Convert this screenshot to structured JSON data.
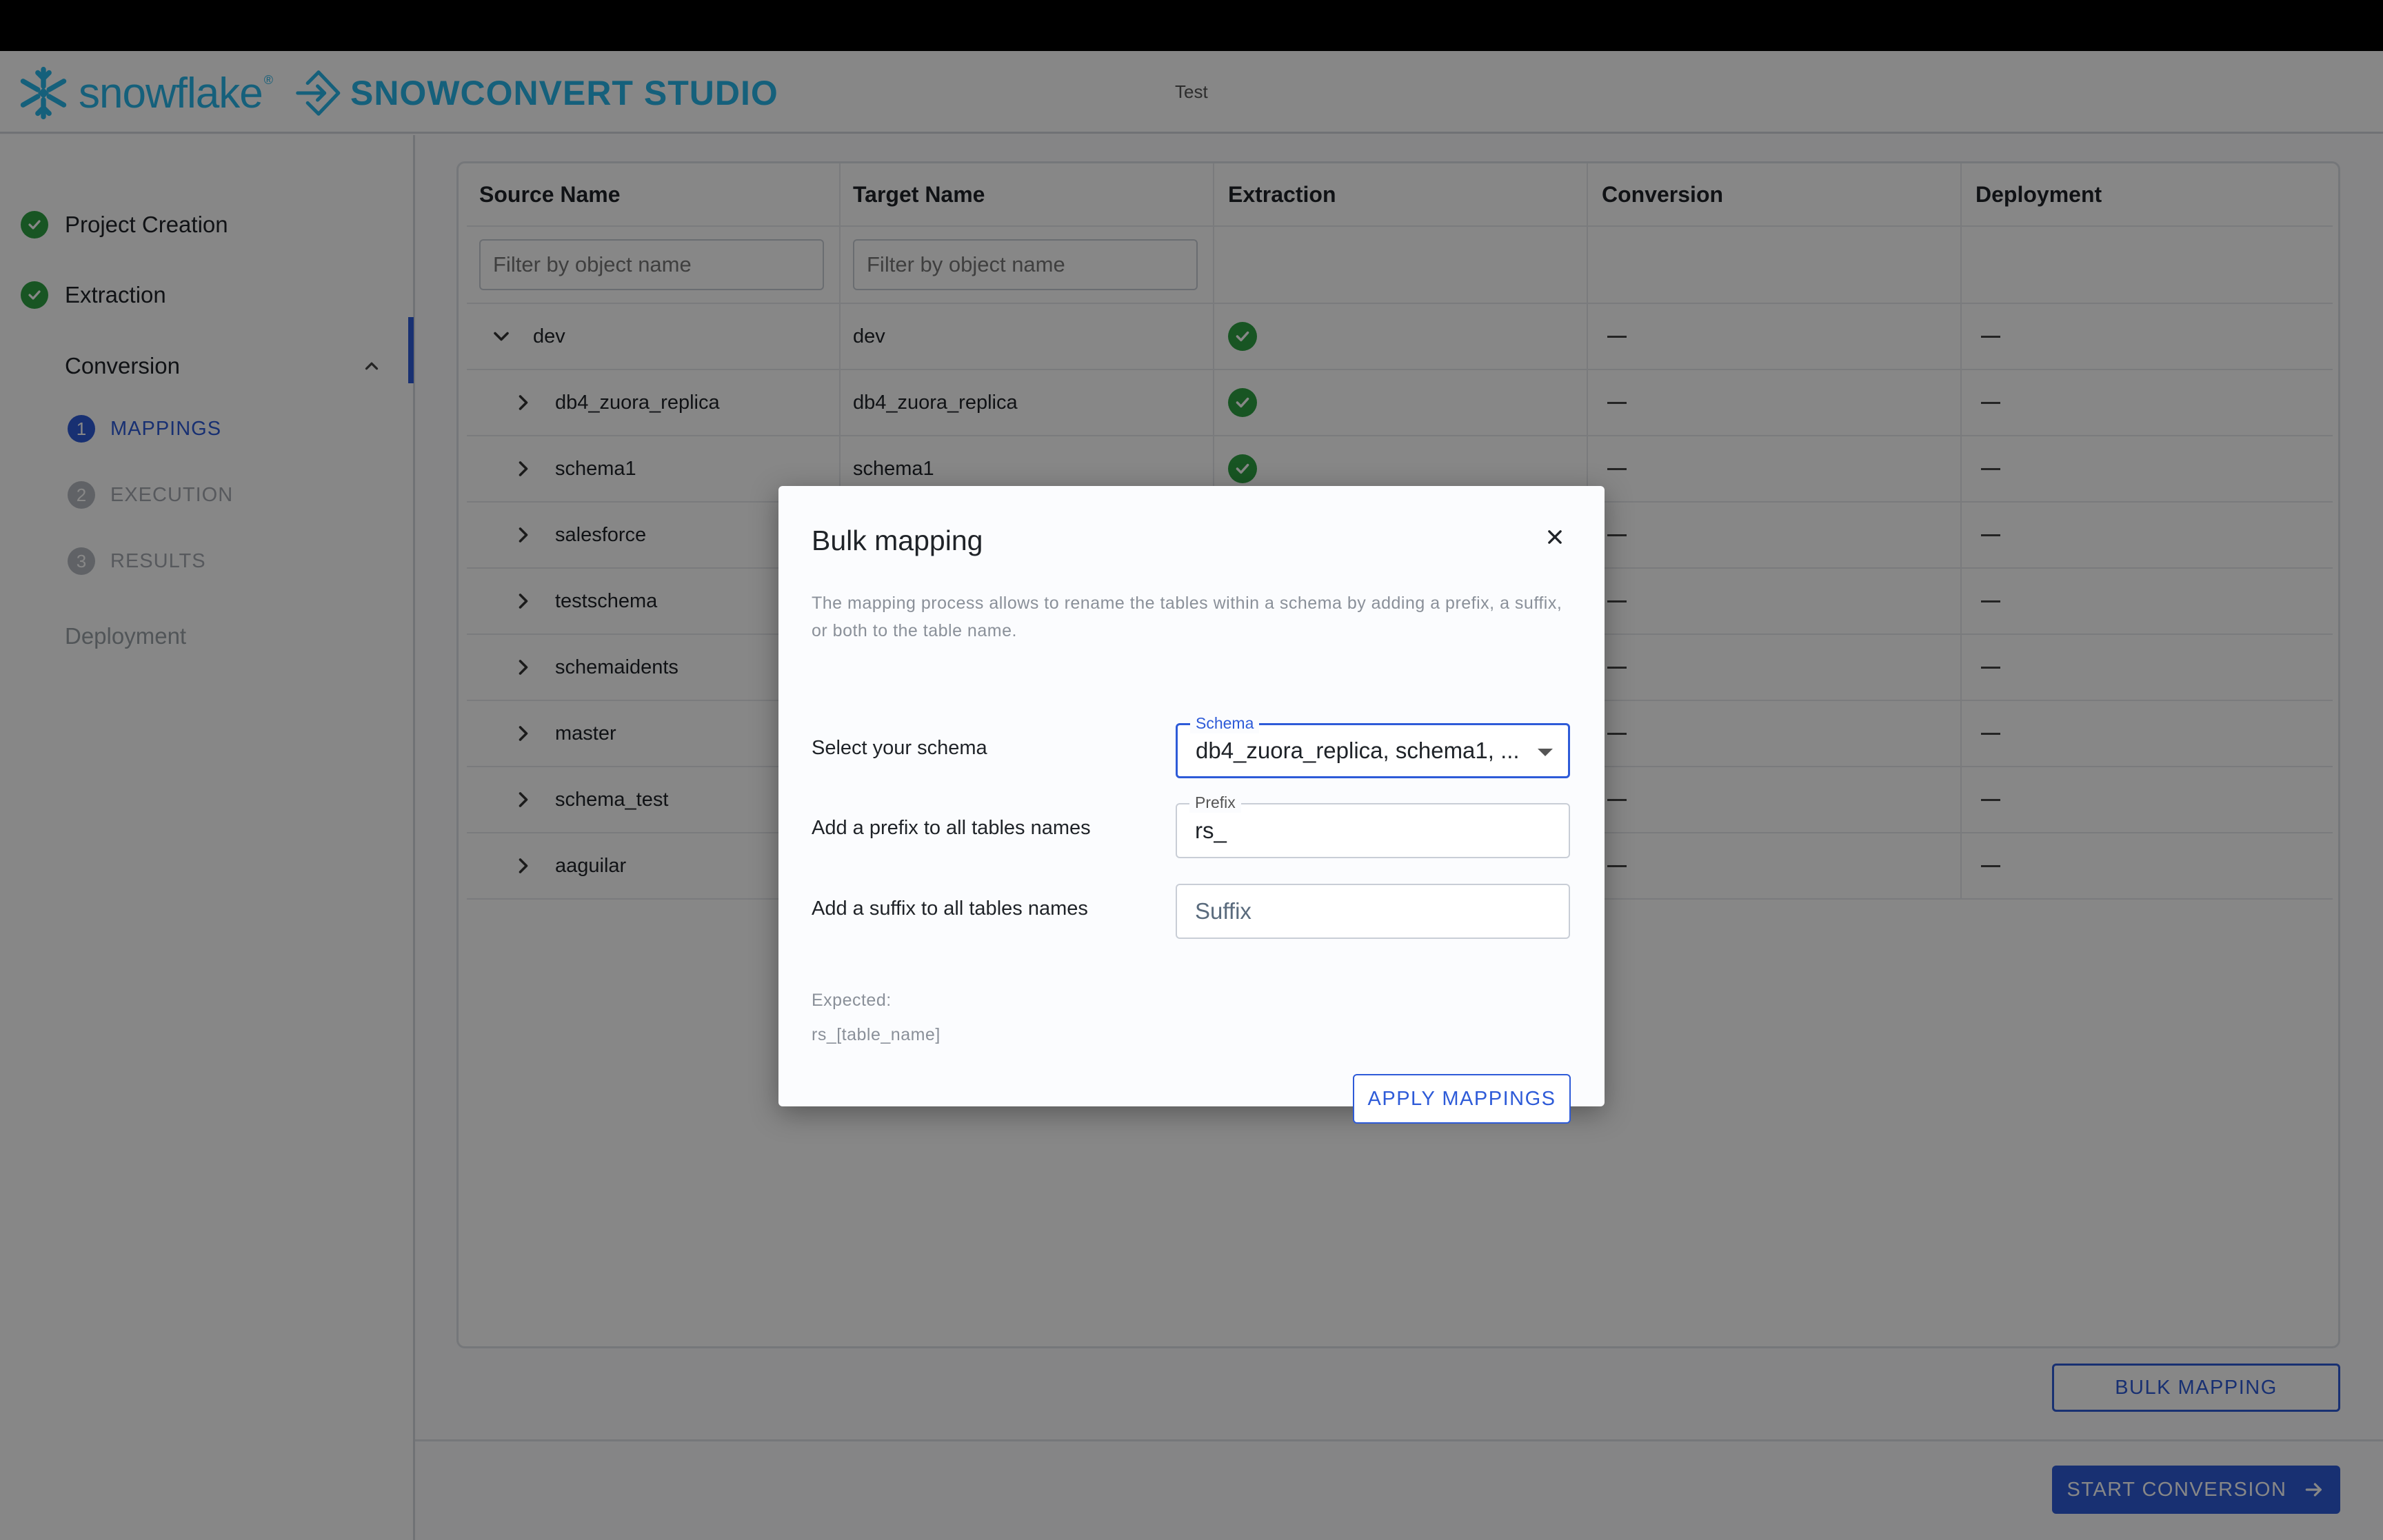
{
  "header": {
    "snowflake_logo_text": "snowflake",
    "snowflake_tm": "®",
    "product_name": "SNOWCONVERT STUDIO",
    "project_title": "Test"
  },
  "sidebar": {
    "steps": [
      {
        "label": "Project Creation",
        "status": "complete"
      },
      {
        "label": "Extraction",
        "status": "complete"
      }
    ],
    "conversion": {
      "label": "Conversion",
      "substeps": [
        {
          "number": "1",
          "label": "MAPPINGS",
          "state": "active"
        },
        {
          "number": "2",
          "label": "EXECUTION",
          "state": "inactive"
        },
        {
          "number": "3",
          "label": "RESULTS",
          "state": "inactive"
        }
      ]
    },
    "deployment_label": "Deployment"
  },
  "table": {
    "columns": [
      "Source Name",
      "Target Name",
      "Extraction",
      "Conversion",
      "Deployment"
    ],
    "filter_placeholder": "Filter by object name",
    "rows": [
      {
        "source": "dev",
        "target": "dev",
        "extraction": "ok",
        "conversion": "—",
        "deployment": "—",
        "expanded": true,
        "level": 0
      },
      {
        "source": "db4_zuora_replica",
        "target": "db4_zuora_replica",
        "extraction": "ok",
        "conversion": "—",
        "deployment": "—",
        "expanded": false,
        "level": 1
      },
      {
        "source": "schema1",
        "target": "schema1",
        "extraction": "ok",
        "conversion": "—",
        "deployment": "—",
        "expanded": false,
        "level": 1
      },
      {
        "source": "salesforce",
        "target": "",
        "extraction": "",
        "conversion": "—",
        "deployment": "—",
        "expanded": false,
        "level": 1
      },
      {
        "source": "testschema",
        "target": "",
        "extraction": "",
        "conversion": "—",
        "deployment": "—",
        "expanded": false,
        "level": 1
      },
      {
        "source": "schemaidents",
        "target": "",
        "extraction": "",
        "conversion": "—",
        "deployment": "—",
        "expanded": false,
        "level": 1
      },
      {
        "source": "master",
        "target": "",
        "extraction": "",
        "conversion": "—",
        "deployment": "—",
        "expanded": false,
        "level": 1
      },
      {
        "source": "schema_test",
        "target": "",
        "extraction": "",
        "conversion": "—",
        "deployment": "—",
        "expanded": false,
        "level": 1
      },
      {
        "source": "aaguilar",
        "target": "",
        "extraction": "",
        "conversion": "—",
        "deployment": "—",
        "expanded": false,
        "level": 1
      }
    ]
  },
  "actions": {
    "bulk_mapping_label": "BULK MAPPING",
    "start_conversion_label": "START CONVERSION"
  },
  "modal": {
    "title": "Bulk mapping",
    "description": "The mapping process allows to rename the tables within a schema by adding a prefix, a suffix, or both to the table name.",
    "schema": {
      "row_label": "Select your schema",
      "legend": "Schema",
      "value": "db4_zuora_replica, schema1, ..."
    },
    "prefix": {
      "row_label": "Add a prefix to all tables names",
      "legend": "Prefix",
      "value": "rs_"
    },
    "suffix": {
      "row_label": "Add a suffix to all tables names",
      "placeholder": "Suffix",
      "value": ""
    },
    "expected_label": "Expected:",
    "expected_value": "rs_[table_name]",
    "apply_label": "APPLY MAPPINGS"
  },
  "colors": {
    "accent": "#2e5bd8",
    "success": "#2ea043",
    "brand": "#29b5e8"
  }
}
